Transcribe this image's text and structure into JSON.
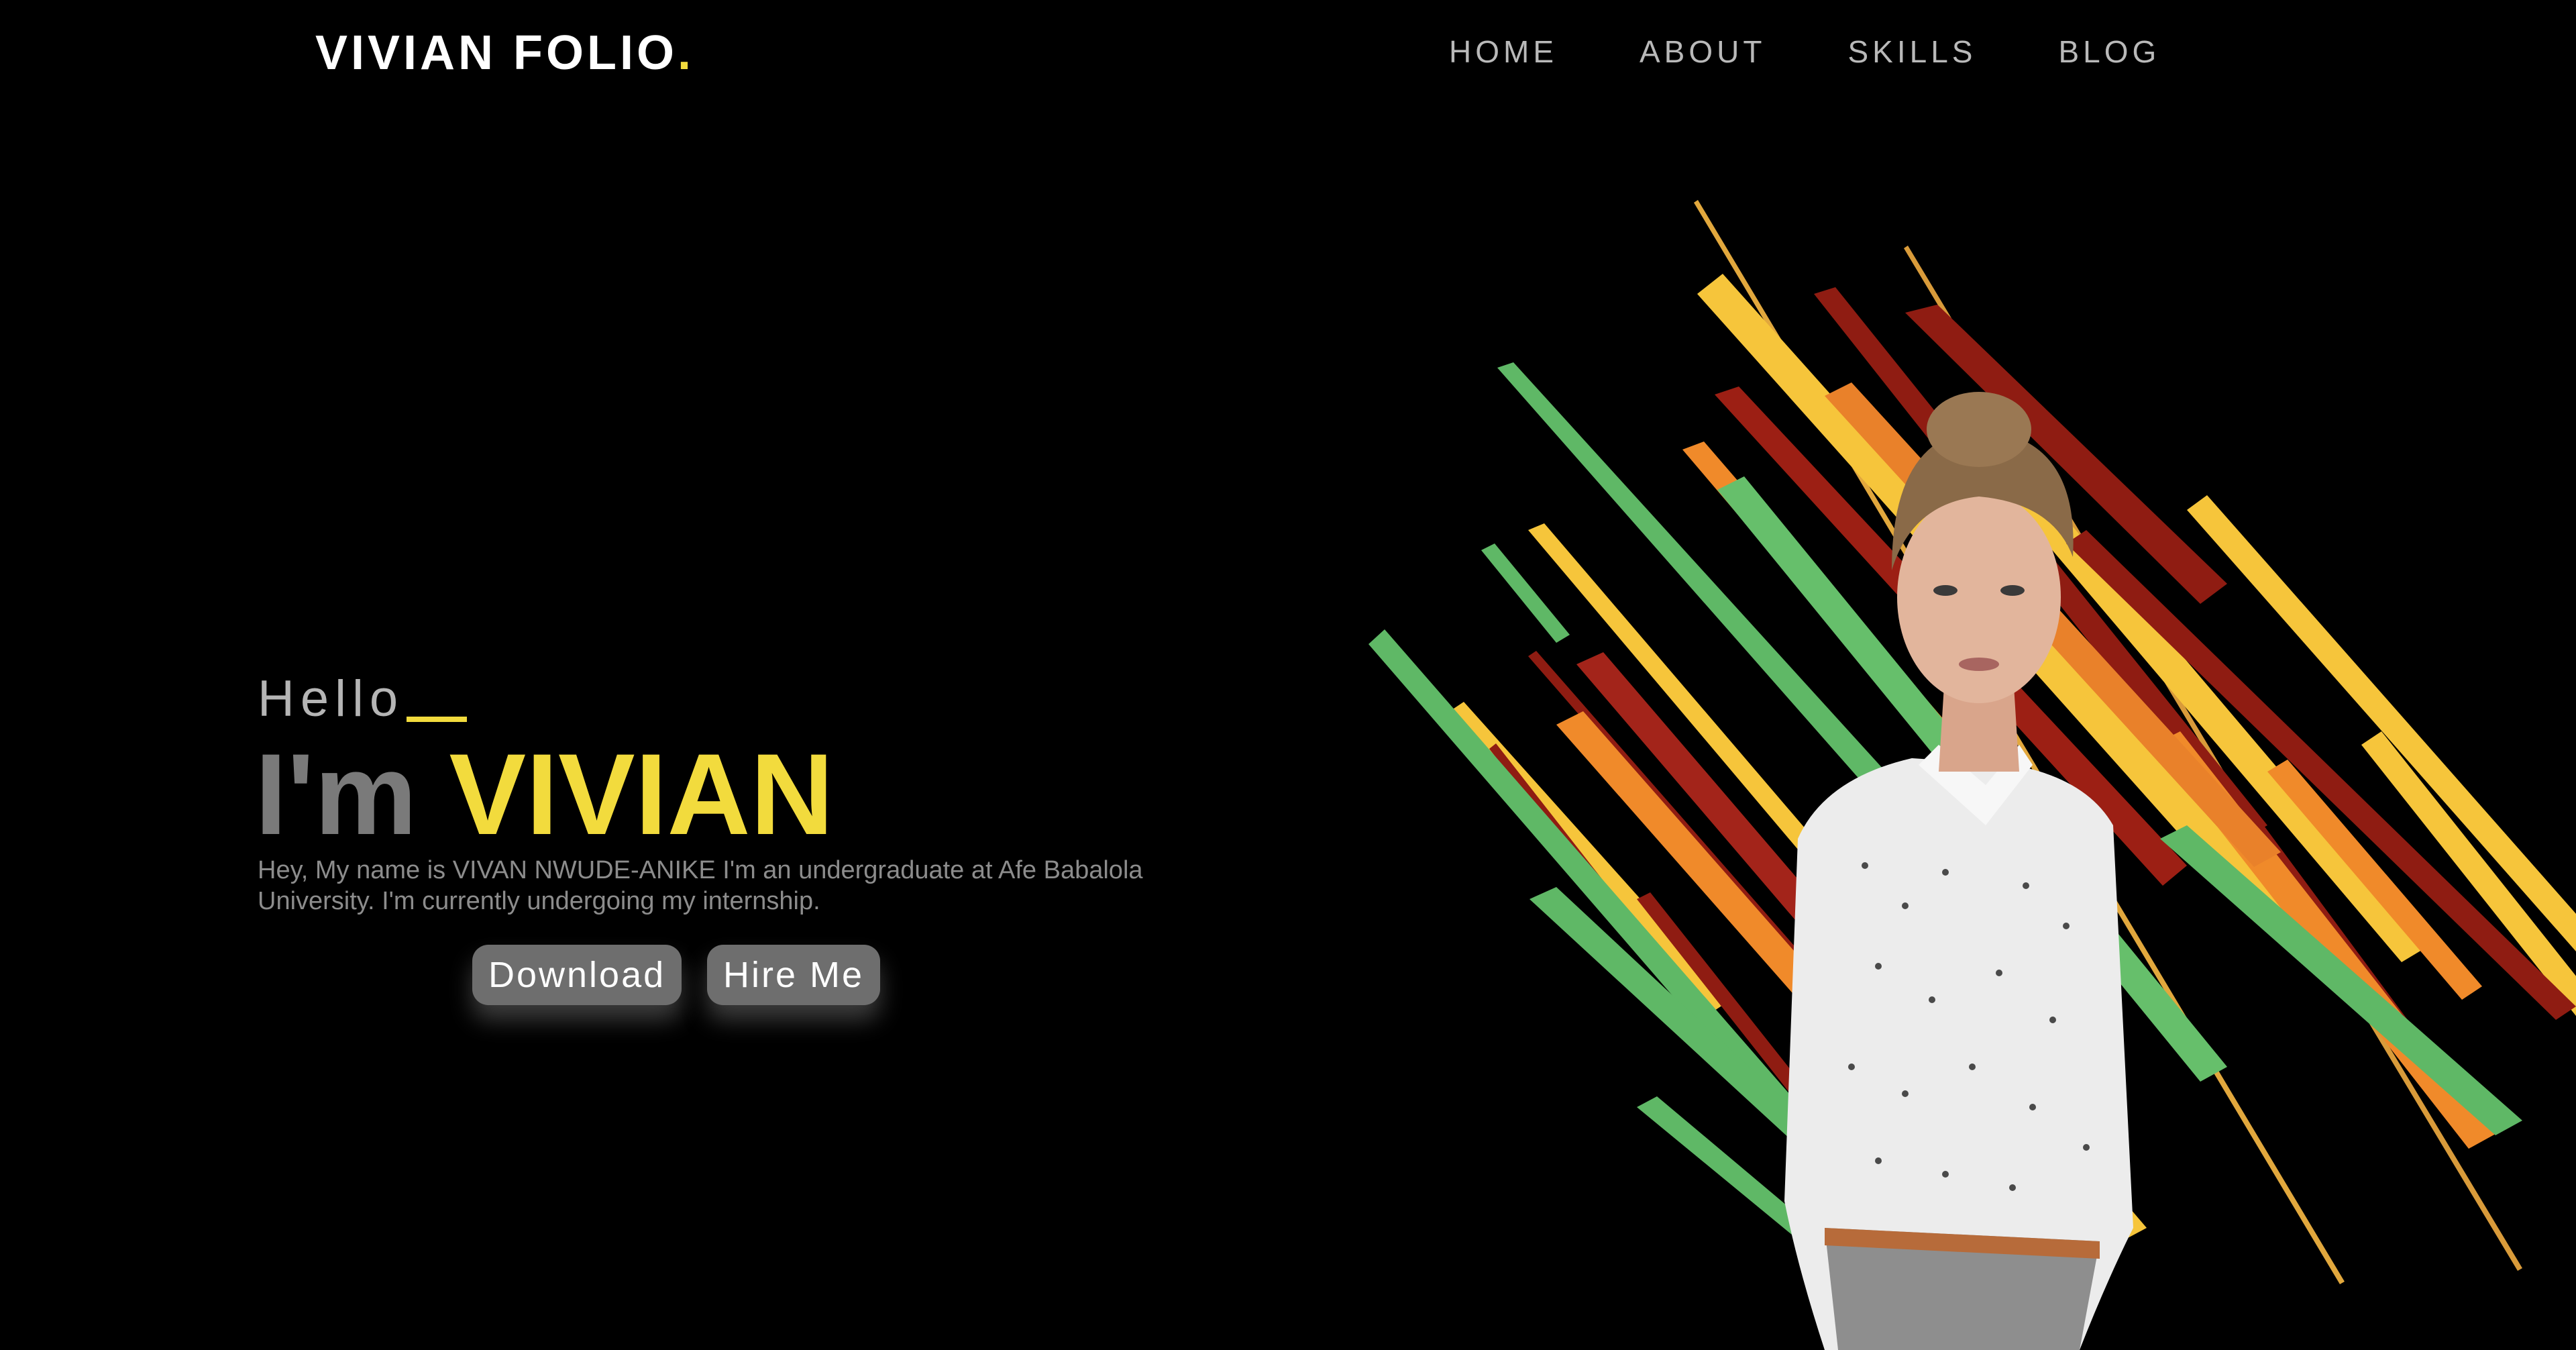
{
  "header": {
    "logo_text": "VIVIAN FOLIO",
    "logo_dot": ".",
    "nav": [
      {
        "label": "HOME"
      },
      {
        "label": "ABOUT"
      },
      {
        "label": "SKILLS"
      },
      {
        "label": "BLOG"
      }
    ]
  },
  "hero": {
    "greeting": "Hello",
    "title_prefix": "I'm ",
    "title_name": "VIVIAN",
    "intro": "Hey, My name is VIVAN NWUDE-ANIKE I'm an undergraduate at Afe Babalola University. I'm currently undergoing my internship.",
    "download_label": "Download",
    "hire_label": "Hire Me"
  },
  "colors": {
    "background": "#000000",
    "accent": "#f2db3d",
    "button": "#6e6e6e",
    "stripe_green": "#5fb866",
    "stripe_yellow": "#f6c53b",
    "stripe_orange": "#f08a2a",
    "stripe_red": "#8f1c12"
  },
  "icons": {
    "hero_image": "portrait-with-diagonal-stripes"
  }
}
